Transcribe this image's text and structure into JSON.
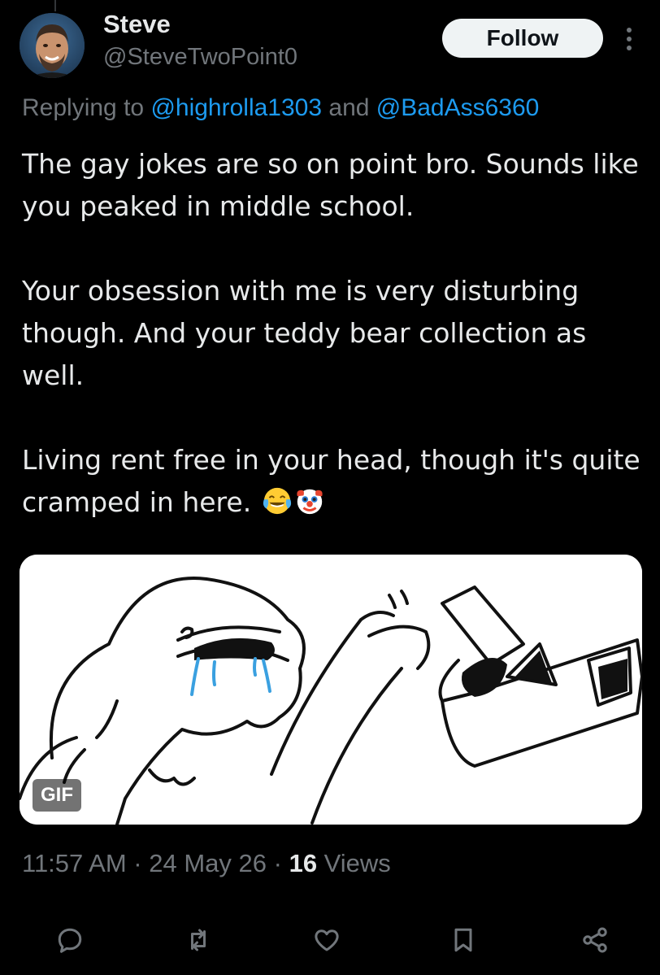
{
  "user": {
    "display_name": "Steve",
    "handle": "@SteveTwoPoint0",
    "avatar_icon": "profile-photo"
  },
  "follow_button": {
    "label": "Follow"
  },
  "more_icon": "more-vertical-icon",
  "reply_context": {
    "prefix": "Replying to ",
    "mention_1": "@highrolla1303",
    "joiner": " and ",
    "mention_2": "@BadAss6360"
  },
  "tweet": {
    "paragraphs": [
      "The gay jokes are so on point bro. Sounds like you peaked in middle school.",
      "Your obsession with me is very disturbing though. And your teddy bear collection as well.",
      "Living rent free in your head, though it's quite cramped in here."
    ],
    "trailing_emojis": [
      "face-with-tears-of-joy-emoji",
      "clown-face-emoji"
    ]
  },
  "media": {
    "type_badge": "GIF",
    "description_icon": "wojak-shape-sorter-gif"
  },
  "meta": {
    "time": "11:57 AM",
    "separator": " · ",
    "date": "24 May 26",
    "views_count": "16",
    "views_label": " Views"
  },
  "actions": [
    {
      "name": "reply-button",
      "icon": "reply-icon"
    },
    {
      "name": "retweet-button",
      "icon": "retweet-icon"
    },
    {
      "name": "like-button",
      "icon": "heart-icon"
    },
    {
      "name": "bookmark-button",
      "icon": "bookmark-icon"
    },
    {
      "name": "share-button",
      "icon": "share-icon"
    }
  ],
  "colors": {
    "background": "#000000",
    "text_primary": "#e7e9ea",
    "text_secondary": "#71767b",
    "link": "#1d9bf0",
    "follow_bg": "#eff3f4"
  }
}
